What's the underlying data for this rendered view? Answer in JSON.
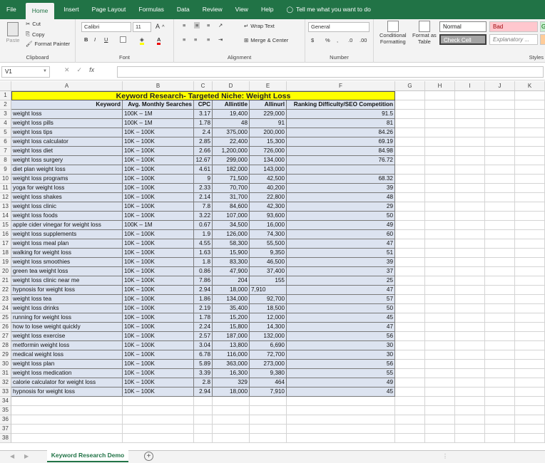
{
  "menu": {
    "tabs": [
      "File",
      "Home",
      "Insert",
      "Page Layout",
      "Formulas",
      "Data",
      "Review",
      "View",
      "Help"
    ],
    "active": "Home",
    "tell_me": "Tell me what you want to do"
  },
  "ribbon": {
    "clipboard": {
      "paste": "Paste",
      "cut": "Cut",
      "copy": "Copy",
      "format_painter": "Format Painter",
      "label": "Clipboard"
    },
    "font": {
      "name": "Calibri",
      "size": "11",
      "label": "Font"
    },
    "alignment": {
      "wrap": "Wrap Text",
      "merge": "Merge & Center",
      "label": "Alignment"
    },
    "number": {
      "format": "General",
      "label": "Number"
    },
    "styles": {
      "conditional": "Conditional",
      "conditional2": "Formatting",
      "format_as": "Format as",
      "format_as2": "Table",
      "normal": "Normal",
      "bad": "Bad",
      "good": "G",
      "check": "Check Cell",
      "explanatory": "Explanatory ...",
      "label": "Styles"
    }
  },
  "formula_bar": {
    "name_box": "V1",
    "fx": "fx",
    "content": ""
  },
  "columns": [
    "A",
    "B",
    "C",
    "D",
    "E",
    "F",
    "G",
    "H",
    "I",
    "J",
    "K"
  ],
  "title": "Keyword Research- Targeted Niche: Weight Loss",
  "headers": [
    "Keyword",
    "Avg. Monthly Searches",
    "CPC",
    "Allintitle",
    "Allinurl",
    "Ranking Difficulty/SEO Competition"
  ],
  "rows": [
    [
      "weight loss",
      "100K – 1M",
      "3.17",
      "19,400",
      "229,000",
      "91.5"
    ],
    [
      "weight loss pills",
      "100K – 1M",
      "1.78",
      "48",
      "91",
      "81"
    ],
    [
      "weight loss tips",
      "10K – 100K",
      "2.4",
      "375,000",
      "200,000",
      "84.26"
    ],
    [
      "weight loss calculator",
      "10K – 100K",
      "2.85",
      "22,400",
      "15,300",
      "69.19"
    ],
    [
      "weight loss diet",
      "10K – 100K",
      "2.66",
      "1,200,000",
      "726,000",
      "84.98"
    ],
    [
      "weight loss surgery",
      "10K – 100K",
      "12.67",
      "299,000",
      "134,000",
      "76.72"
    ],
    [
      "diet plan weight loss",
      "10K – 100K",
      "4.61",
      "182,000",
      "143,000",
      ""
    ],
    [
      "weight loss programs",
      "10K – 100K",
      "9",
      "71,500",
      "42,500",
      "68.32"
    ],
    [
      "yoga for weight loss",
      "10K – 100K",
      "2.33",
      "70,700",
      "40,200",
      "39"
    ],
    [
      "weight loss shakes",
      "10K – 100K",
      "2.14",
      "31,700",
      "22,800",
      "48"
    ],
    [
      "weight loss clinic",
      "10K – 100K",
      "7.8",
      "84,600",
      "42,300",
      "29"
    ],
    [
      "weight loss foods",
      "10K – 100K",
      "3.22",
      "107,000",
      "93,600",
      "50"
    ],
    [
      "apple cider vinegar for weight loss",
      "100K – 1M",
      "0.67",
      "34,500",
      "16,000",
      "49"
    ],
    [
      "weight loss supplements",
      "10K – 100K",
      "1.9",
      "126,000",
      "74,300",
      "60"
    ],
    [
      "weight loss meal plan",
      "10K – 100K",
      "4.55",
      "58,300",
      "55,500",
      "47"
    ],
    [
      "walking for weight loss",
      "10K – 100K",
      "1.63",
      "15,900",
      "9,350",
      "51"
    ],
    [
      "weight loss smoothies",
      "10K – 100K",
      "1.8",
      "83,300",
      "46,500",
      "39"
    ],
    [
      "green tea weight loss",
      "10K – 100K",
      "0.86",
      "47,900",
      "37,400",
      "37"
    ],
    [
      "weight loss clinic near me",
      "10K – 100K",
      "7.86",
      "204",
      "155",
      "25"
    ],
    [
      "hypnosis for weight loss",
      "10K – 100K",
      "2.94",
      "18,000",
      "7,910",
      "47"
    ],
    [
      "weight loss tea",
      "10K – 100K",
      "1.86",
      "134,000",
      "92,700",
      "57"
    ],
    [
      "weight loss drinks",
      "10K – 100K",
      "2.19",
      "35,400",
      "18,500",
      "50"
    ],
    [
      "running for weight loss",
      "10K – 100K",
      "1.78",
      "15,200",
      "12,000",
      "45"
    ],
    [
      "how to lose weight quickly",
      "10K – 100K",
      "2.24",
      "15,800",
      "14,300",
      "47"
    ],
    [
      "weight loss exercise",
      "10K – 100K",
      "2.57",
      "187,000",
      "132,000",
      "56"
    ],
    [
      "metformin weight loss",
      "10K – 100K",
      "3.04",
      "13,800",
      "6,690",
      "30"
    ],
    [
      "medical weight loss",
      "10K – 100K",
      "6.78",
      "116,000",
      "72,700",
      "30"
    ],
    [
      "weight loss plan",
      "10K – 100K",
      "5.89",
      "363,000",
      "273,000",
      "56"
    ],
    [
      "weight loss medication",
      "10K – 100K",
      "3.39",
      "16,300",
      "9,380",
      "55"
    ],
    [
      "calorie calculator for weight loss",
      "10K – 100K",
      "2.8",
      "329",
      "464",
      "49"
    ],
    [
      "hypnosis for weight loss",
      "10K – 100K",
      "2.94",
      "18,000",
      "7,910",
      "45"
    ]
  ],
  "row_numbers": [
    "1",
    "2",
    "3",
    "4",
    "5",
    "6",
    "7",
    "8",
    "9",
    "10",
    "11",
    "12",
    "13",
    "14",
    "15",
    "16",
    "17",
    "18",
    "19",
    "20",
    "21",
    "22",
    "23",
    "24",
    "25",
    "26",
    "27",
    "28",
    "29",
    "30",
    "31",
    "32",
    "33",
    "34",
    "35",
    "36",
    "37",
    "38"
  ],
  "sheet_tab": "Keyword Research Demo",
  "colors": {
    "excel_green": "#217346",
    "title_fill": "#ffff00",
    "table_fill": "#dce3f0"
  }
}
